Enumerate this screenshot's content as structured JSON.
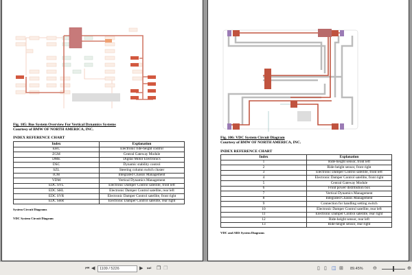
{
  "left_page": {
    "fig_title": "Fig. 105: Bus System Overview For Vertical Dynamics Systems",
    "courtesy": "Courtesy of BMW OF NORTH AMERICA, INC.",
    "chart_heading": "INDEX REFERENCE CHART",
    "headers": [
      "Index",
      "Explanation"
    ],
    "rows": [
      [
        "EHC",
        "Electronic ride-height control"
      ],
      [
        "ZGM",
        "Central Gateway Module"
      ],
      [
        "DME",
        "Digital Motor Electronics"
      ],
      [
        "DSC",
        "Dynamic stability control"
      ],
      [
        "SZL",
        "Steering column switch cluster"
      ],
      [
        "ICM",
        "Integrated Chassis Management"
      ],
      [
        "VDM",
        "Vertical Dynamics Management"
      ],
      [
        "EDC SVL",
        "Electronic Damper Control satellite, front left"
      ],
      [
        "EDC SHL",
        "Electronic Damper Control satellite, rear left"
      ],
      [
        "EDC SVR",
        "Electronic Damper Control satellite, front right"
      ],
      [
        "EDC SHR",
        "Electronic Damper Control satellite, rear right"
      ]
    ],
    "section1": "System Circuit Diagrams",
    "section2": "VDC System Circuit Diagram"
  },
  "right_page": {
    "fig_title": "Fig. 106: VDC System Circuit Diagram",
    "courtesy": "Courtesy of BMW OF NORTH AMERICA, INC.",
    "chart_heading": "INDEX REFERENCE CHART",
    "headers": [
      "Index",
      "Explanation"
    ],
    "rows": [
      [
        "1",
        "Ride-height sensor, front left"
      ],
      [
        "2",
        "Ride-height sensor, front right"
      ],
      [
        "3",
        "Electronic Damper Control satellite, front left"
      ],
      [
        "4",
        "Electronic Damper Control satellite, front right"
      ],
      [
        "5",
        "Central Gateway Module"
      ],
      [
        "6",
        "Front power distribution box"
      ],
      [
        "7",
        "Vertical Dynamics Management"
      ],
      [
        "8",
        "Integrated Chassis Management"
      ],
      [
        "9",
        "Connection for handling setting switch"
      ],
      [
        "10",
        "Electronic Damper Control satellite, rear left"
      ],
      [
        "11",
        "Electronic Damper Control satellite, rear right"
      ],
      [
        "12",
        "Ride-height sensor, rear left"
      ],
      [
        "13",
        "Ride-height sensor, rear right"
      ]
    ],
    "section1": "VDC and ARS System Diagrams"
  },
  "toolbar": {
    "page_value": "1109 / 5226",
    "zoom": "89.45%"
  },
  "colors": {
    "wire_red": "#c0533f",
    "module": "#b86a6a",
    "sensor": "#9b7bb5",
    "wire_gray": "#b8b8b8"
  }
}
